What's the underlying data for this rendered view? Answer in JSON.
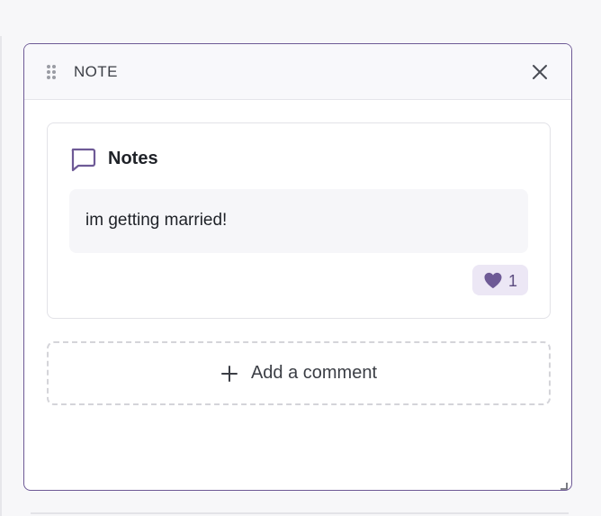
{
  "panel": {
    "title": "NOTE",
    "icons": {
      "drag": "drag-handle-icon",
      "close": "close-icon",
      "resize": "resize-grip-icon"
    },
    "accent_color": "#6e5a96"
  },
  "notes_card": {
    "title": "Notes",
    "title_icon": "comment-icon",
    "note_text": "im getting married!",
    "likes": {
      "icon": "heart-icon",
      "count": "1",
      "color": "#6e5a96"
    }
  },
  "add_comment": {
    "label": "Add a comment",
    "icon": "plus-icon"
  }
}
